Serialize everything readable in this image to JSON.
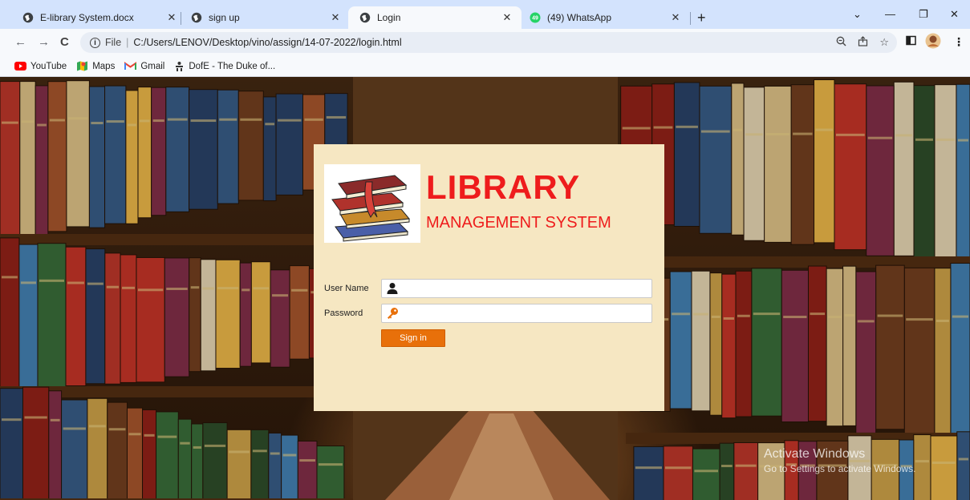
{
  "browser": {
    "tabs": [
      {
        "label": "E-library System.docx",
        "active": false
      },
      {
        "label": "sign up",
        "active": false
      },
      {
        "label": "Login",
        "active": true
      },
      {
        "label": "(49) WhatsApp",
        "active": false
      }
    ],
    "whatsapp_badge": "49",
    "address": {
      "scheme": "File",
      "url": "C:/Users/LENOV/Desktop/vino/assign/14-07-2022/login.html"
    },
    "bookmarks": [
      {
        "label": "YouTube",
        "icon": "youtube-icon"
      },
      {
        "label": "Maps",
        "icon": "maps-icon"
      },
      {
        "label": "Gmail",
        "icon": "gmail-icon"
      },
      {
        "label": "DofE - The Duke of...",
        "icon": "dofe-icon"
      }
    ]
  },
  "login": {
    "title": "LIBRARY",
    "subtitle": "MANAGEMENT SYSTEM",
    "username_label": "User Name",
    "username_value": "",
    "password_label": "Password",
    "password_value": "",
    "signin_label": "Sign in"
  },
  "os_watermark": {
    "line1": "Activate Windows",
    "line2": "Go to Settings to activate Windows."
  },
  "colors": {
    "title_red": "#ee1c1c",
    "card_bg": "#f6e7c2",
    "signin_orange": "#e8700a",
    "chrome_tab_bar": "#d3e3fd"
  }
}
